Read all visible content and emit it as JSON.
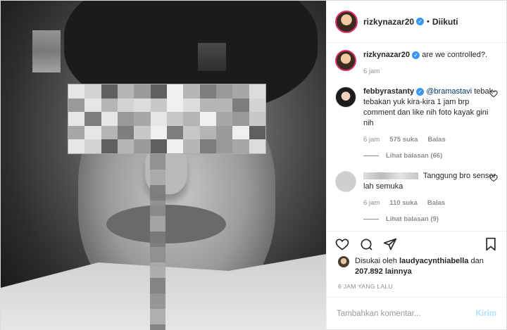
{
  "post": {
    "username": "rizkynazar20",
    "follow_status": "Diikuti",
    "caption": "are we controlled?.",
    "caption_time": "6 jam"
  },
  "comments": [
    {
      "username": "febbyrastanty",
      "mention": "@bramastavi",
      "text": "tebak-tebakan yuk kira-kira 1 jam brp comment dan like nih foto kayak gini nih",
      "time": "6 jam",
      "likes": "575 suka",
      "reply": "Balas",
      "view_replies": "Lihat balasan (66)"
    },
    {
      "username": "",
      "text": "Tanggung bro sensor lah semuka",
      "time": "6 jam",
      "likes": "110 suka",
      "reply": "Balas",
      "view_replies": "Lihat balasan (9)"
    }
  ],
  "likes_summary": {
    "prefix": "Disukai oleh",
    "user": "laudyacynthiabella",
    "joiner": "dan",
    "count": "207.892 lainnya"
  },
  "timestamp": "6 JAM YANG LALU",
  "comment_box": {
    "placeholder": "Tambahkan komentar...",
    "send_label": "Kirim"
  },
  "colors": {
    "accent": "#3897f0",
    "send_disabled": "#b2dffc",
    "muted": "#8e8e8e"
  }
}
